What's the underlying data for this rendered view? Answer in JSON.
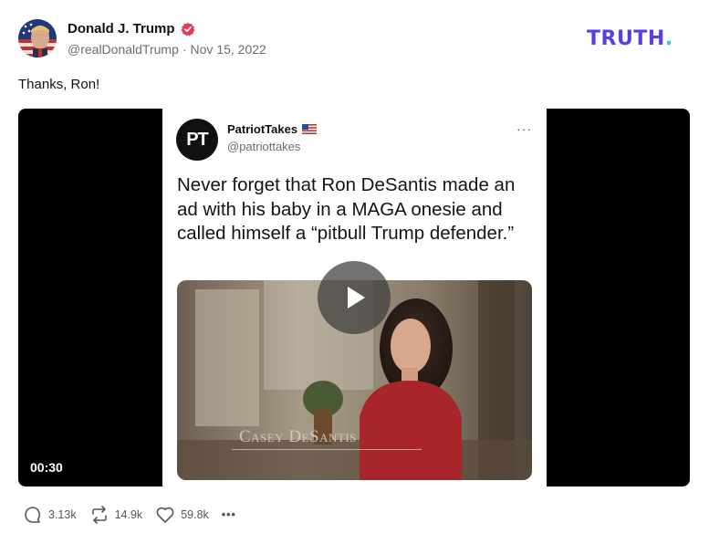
{
  "header": {
    "author_name": "Donald J. Trump",
    "handle": "@realDonaldTrump",
    "separator": "·",
    "date": "Nov 15, 2022"
  },
  "brand": {
    "logo_text": "TRUTH",
    "logo_dot": ".",
    "primary_color": "#5b3fe0",
    "accent_color": "#2fd2c2"
  },
  "post": {
    "text": "Thanks, Ron!"
  },
  "video": {
    "duration": "00:30",
    "embedded_tweet": {
      "avatar_text": "PT",
      "name": "PatriotTakes",
      "handle": "@patriottakes",
      "more": "···",
      "text": "Never forget that Ron DeSantis made an ad with his baby in a MAGA onesie and called himself a “pitbull Trump defender.”",
      "clip_caption": "Casey DeSantis"
    }
  },
  "actions": {
    "replies": "3.13k",
    "retruths": "14.9k",
    "likes": "59.8k",
    "more": "•••"
  }
}
